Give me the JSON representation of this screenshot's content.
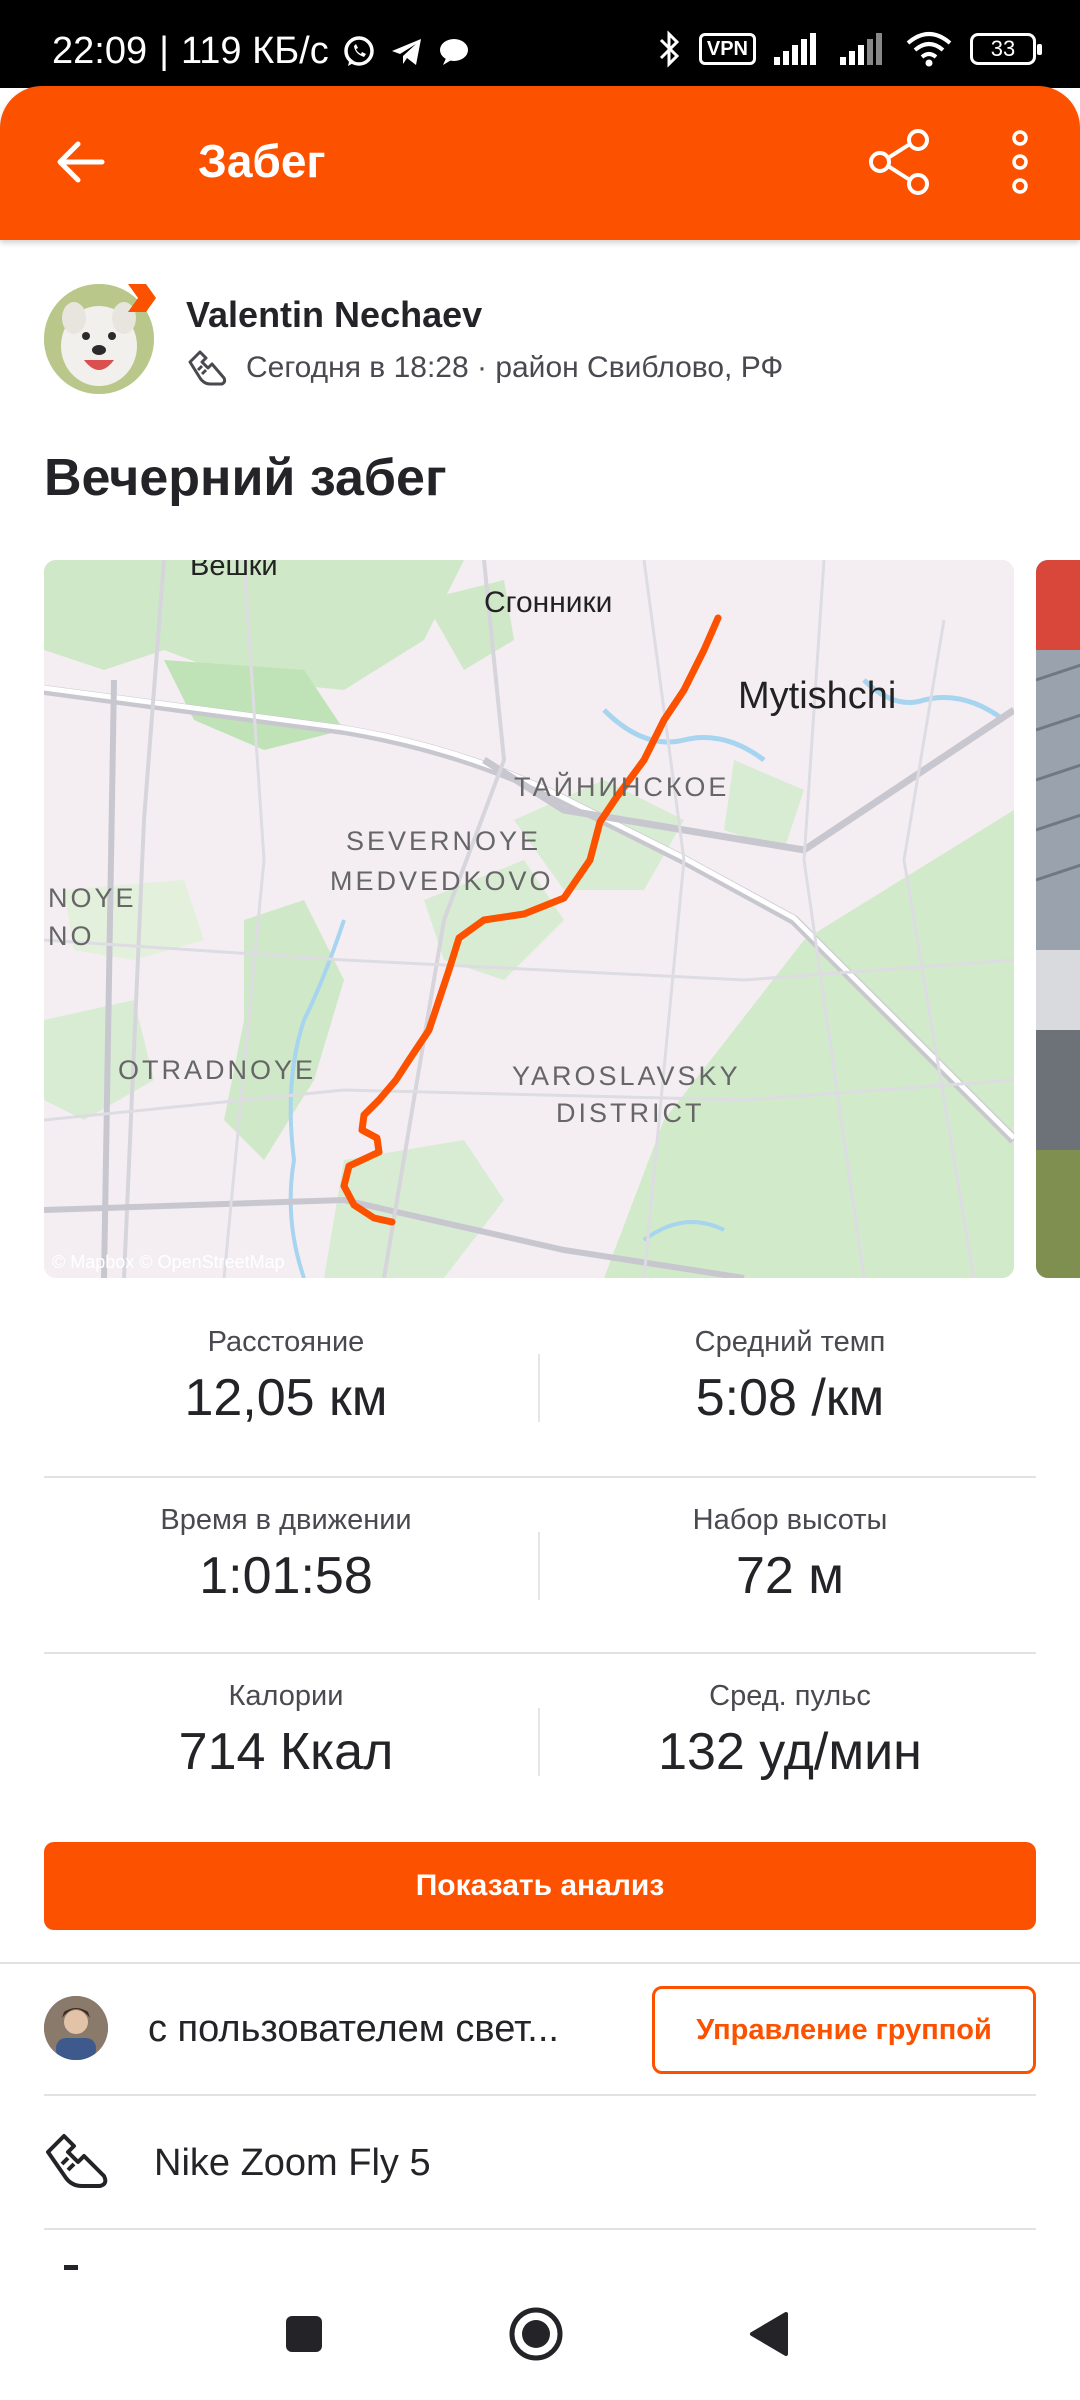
{
  "status_bar": {
    "time": "22:09",
    "speed": "119 КБ/с",
    "vpn": "VPN",
    "battery": "33"
  },
  "header": {
    "title": "Забег"
  },
  "athlete": {
    "name": "Valentin Nechaev",
    "meta": "Сегодня в 18:28 · район Свиблово, РФ"
  },
  "activity": {
    "title": "Вечерний забег"
  },
  "map": {
    "labels": {
      "veshki": "Вешки",
      "sgonniki": "Сгонники",
      "mytishchi": "Mytishchi",
      "tayninskoye": "ТАЙНИНСКОЕ",
      "sev_medvedkovo_1": "SEVERNOYE",
      "sev_medvedkovo_2": "MEDVEDKOVO",
      "noye_1": "NOYE",
      "noye_2": "NO",
      "otradnoye": "OTRADNOYE",
      "yaroslavsky_1": "YAROSLAVSKY",
      "yaroslavsky_2": "DISTRICT",
      "attribution": "© Mapbox © OpenStreetMap"
    },
    "route_color": "#fc5200"
  },
  "stats": [
    {
      "label": "Расстояние",
      "value": "12,05 км"
    },
    {
      "label": "Средний темп",
      "value": "5:08 /км"
    },
    {
      "label": "Время в движении",
      "value": "1:01:58"
    },
    {
      "label": "Набор высоты",
      "value": "72 м"
    },
    {
      "label": "Калории",
      "value": "714 Ккал"
    },
    {
      "label": "Сред. пульс",
      "value": "132 уд/мин"
    }
  ],
  "analysis_button": "Показать анализ",
  "group": {
    "text": "с пользователем свет...",
    "manage_button": "Управление группой"
  },
  "gear": {
    "name": "Nike Zoom Fly 5"
  },
  "colors": {
    "accent": "#fc5200",
    "text": "#242428"
  }
}
